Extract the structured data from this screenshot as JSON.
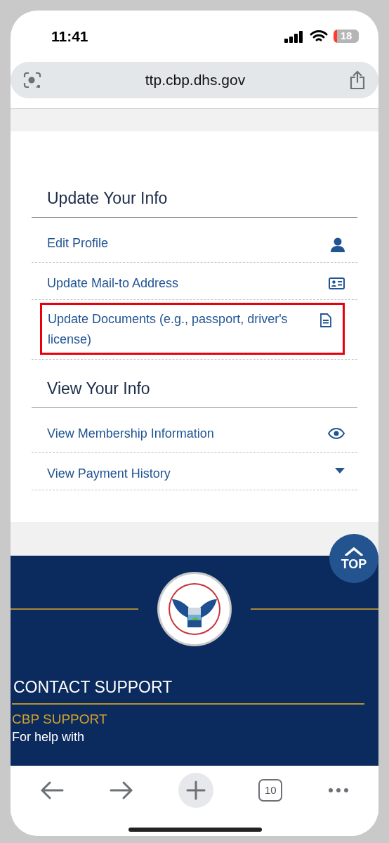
{
  "status_bar": {
    "time": "11:41",
    "battery": "18"
  },
  "address_bar": {
    "url": "ttp.cbp.dhs.gov"
  },
  "sections": [
    {
      "title": "Update Your Info",
      "items": [
        {
          "label": "Edit Profile",
          "kind": "person",
          "highlighted": false
        },
        {
          "label": "Update Mail-to Address",
          "kind": "card",
          "highlighted": false
        },
        {
          "label": "Update Documents (e.g., passport, driver's license)",
          "kind": "document",
          "highlighted": true
        }
      ]
    },
    {
      "title": "View Your Info",
      "items": [
        {
          "label": "View Membership Information",
          "kind": "view",
          "highlighted": false
        },
        {
          "label": "View Payment History",
          "kind": "dropdown",
          "highlighted": false
        }
      ]
    }
  ],
  "top_button": "TOP",
  "footer": {
    "heading": "CONTACT SUPPORT",
    "subheading": "CBP SUPPORT",
    "text": "For help with"
  },
  "toolbar": {
    "tab_count": "10"
  }
}
